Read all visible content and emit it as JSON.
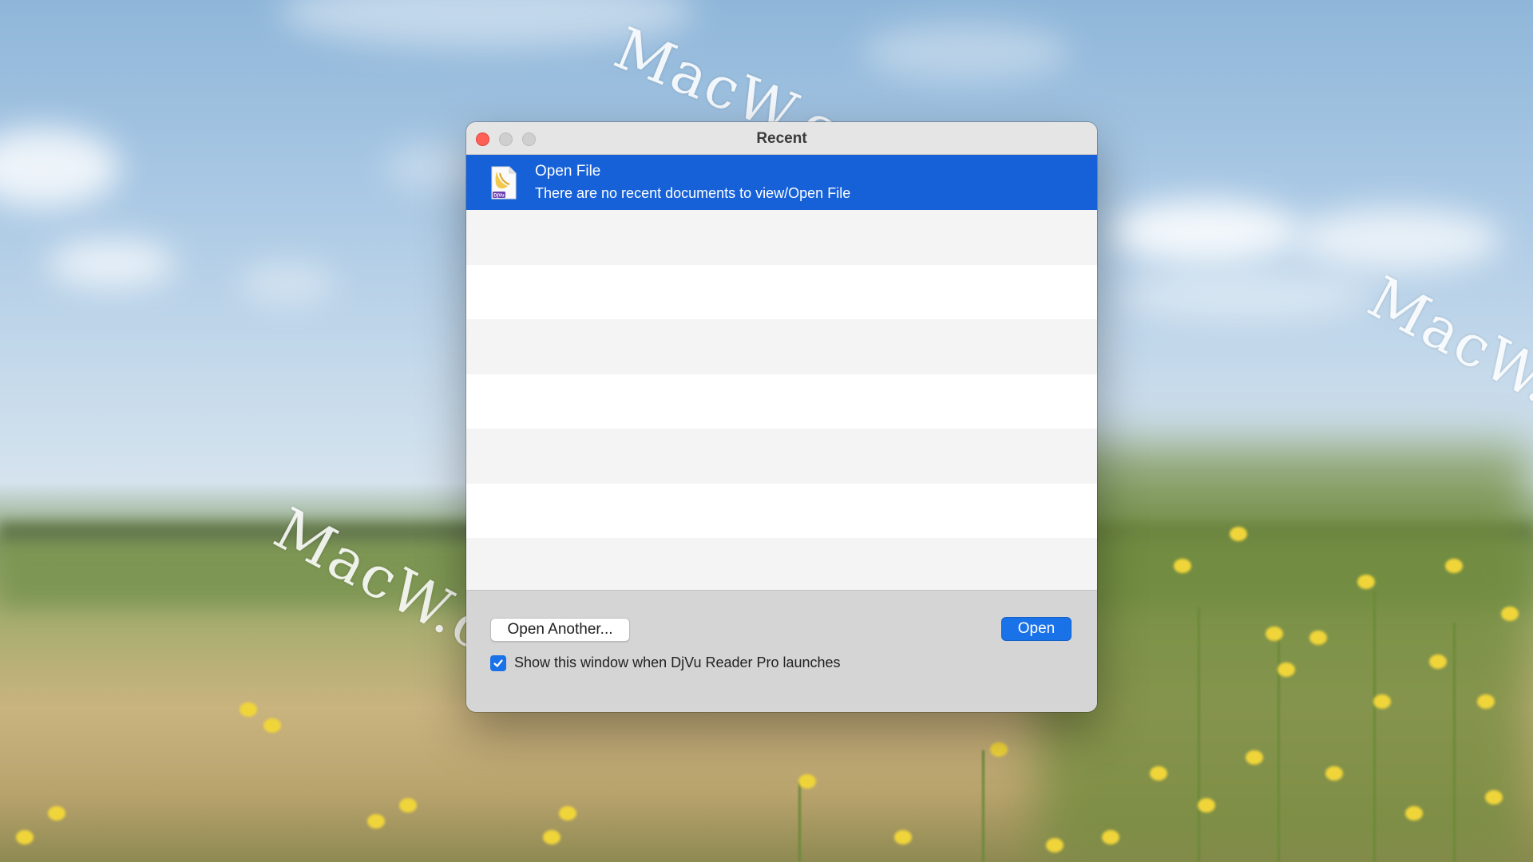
{
  "window": {
    "title": "Recent"
  },
  "recent_list": {
    "selected_item": {
      "title": "Open File",
      "subtitle": "There are no recent documents to view/Open File",
      "icon": "djvu-document-icon",
      "icon_label": "DjVu"
    }
  },
  "footer": {
    "open_another_label": "Open Another...",
    "open_label": "Open",
    "show_on_launch": {
      "label": "Show this window when DjVu Reader Pro launches",
      "checked": true
    }
  },
  "watermark": {
    "text": "MacW.com"
  },
  "colors": {
    "selection": "#1661d8",
    "accent": "#1a72e8",
    "close": "#fe5f57"
  }
}
